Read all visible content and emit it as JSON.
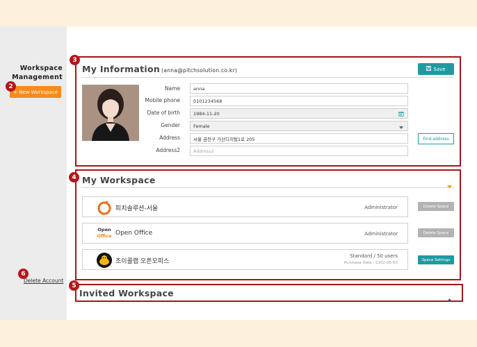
{
  "sidebar": {
    "title_line1": "Workspace",
    "title_line2": "Management",
    "new_workspace": "+ New Workspace",
    "delete_account": "Delete Account"
  },
  "badges": [
    "2",
    "3",
    "4",
    "5",
    "6"
  ],
  "my_information": {
    "title": "My Information",
    "email": "(anna@pitchsolution.co.kr)",
    "save_label": "Save",
    "fields": [
      {
        "label": "Name",
        "value": "anna"
      },
      {
        "label": "Mobile phone",
        "value": "0101234568"
      },
      {
        "label": "Date of birth",
        "value": "1984-11-20"
      },
      {
        "label": "Gender",
        "value": "Female"
      },
      {
        "label": "Address",
        "value": "서울 금천구 가산디지털1로 205"
      },
      {
        "label": "Address2",
        "placeholder": "Address2"
      }
    ],
    "find_address": "Find address"
  },
  "my_workspace": {
    "title": "My Workspace",
    "items": [
      {
        "name": "피치솔루션-서울",
        "role": "Administrator",
        "button": "Delete Space"
      },
      {
        "name": "Open Office",
        "role": "Administrator",
        "button": "Delete Space",
        "logo_line1": "Open",
        "logo_line2": "Office"
      },
      {
        "name": "조이콜랩 오픈오피스",
        "plan": "Standard / 50 users",
        "purchase": "Purchase Date : 2102-06-03",
        "button": "Space Settings"
      }
    ]
  },
  "invited_workspace": {
    "title": "Invited Workspace"
  },
  "colors": {
    "accent_orange": "#f98a1c",
    "teal": "#1f9aa0",
    "badge_red": "#b8141a",
    "highlight_border": "#a6141a"
  }
}
